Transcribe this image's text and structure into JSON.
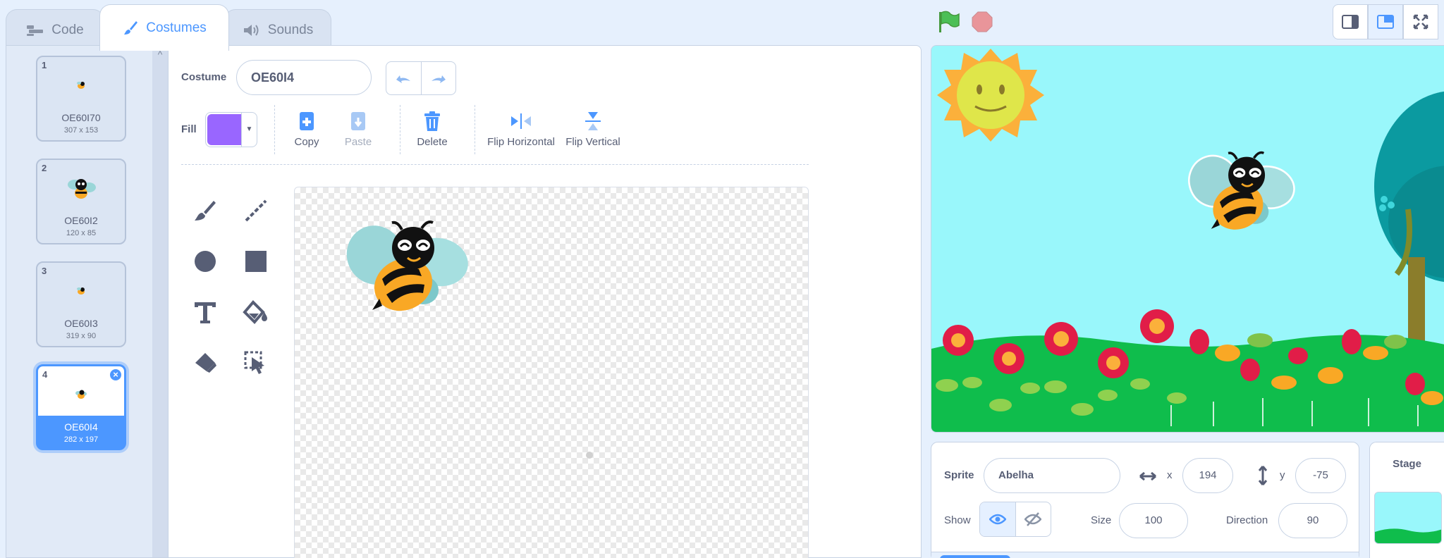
{
  "tabs": [
    {
      "label": "Code",
      "icon": "code-icon"
    },
    {
      "label": "Costumes",
      "icon": "brush-icon"
    },
    {
      "label": "Sounds",
      "icon": "speaker-icon"
    }
  ],
  "costumes": [
    {
      "num": "1",
      "name": "OE60I70",
      "size": "307 x 153"
    },
    {
      "num": "2",
      "name": "OE60I2",
      "size": "120 x 85"
    },
    {
      "num": "3",
      "name": "OE60I3",
      "size": "319 x 90"
    },
    {
      "num": "4",
      "name": "OE60I4",
      "size": "282 x 197"
    }
  ],
  "editor": {
    "costume_label": "Costume",
    "costume_name": "OE60I4",
    "fill_label": "Fill",
    "fill_color": "#9966ff",
    "actions": {
      "copy": "Copy",
      "paste": "Paste",
      "delete": "Delete",
      "flip_horizontal": "Flip Horizontal",
      "flip_vertical": "Flip Vertical"
    }
  },
  "sprite": {
    "label": "Sprite",
    "name": "Abelha",
    "x_label": "x",
    "x": "194",
    "y_label": "y",
    "y": "-75",
    "show_label": "Show",
    "size_label": "Size",
    "size": "100",
    "direction_label": "Direction",
    "direction": "90"
  },
  "stage_target": {
    "label": "Stage"
  },
  "colors": {
    "accent": "#4c97ff",
    "stage_sky": "#99f7fb",
    "grass": "#0fbd4c"
  }
}
